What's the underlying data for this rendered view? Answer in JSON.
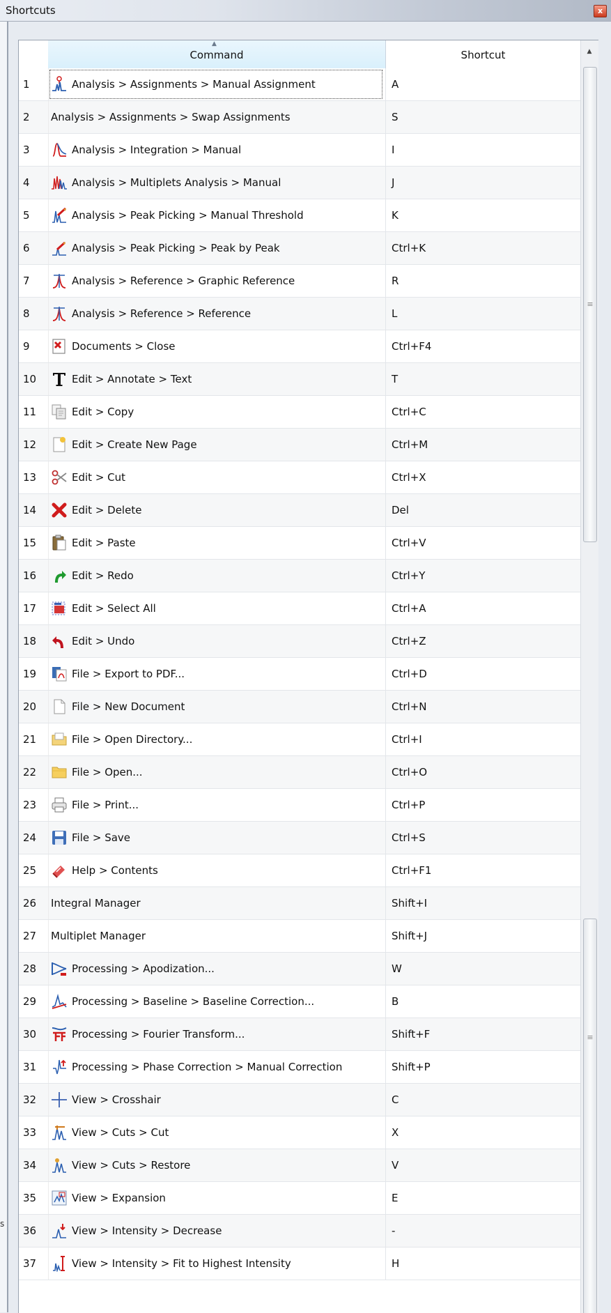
{
  "window": {
    "title": "Shortcuts",
    "close_glyph": "x"
  },
  "table": {
    "columns": {
      "command": "Command",
      "shortcut": "Shortcut"
    },
    "rows": [
      {
        "n": "1",
        "command": "Analysis > Assignments > Manual Assignment",
        "shortcut": "A",
        "icon": "manual-assignment-icon"
      },
      {
        "n": "2",
        "command": "Analysis > Assignments > Swap Assignments",
        "shortcut": "S",
        "icon": ""
      },
      {
        "n": "3",
        "command": "Analysis > Integration > Manual",
        "shortcut": "I",
        "icon": "integration-icon"
      },
      {
        "n": "4",
        "command": "Analysis > Multiplets Analysis > Manual",
        "shortcut": "J",
        "icon": "multiplets-icon"
      },
      {
        "n": "5",
        "command": "Analysis > Peak Picking > Manual Threshold",
        "shortcut": "K",
        "icon": "peak-threshold-icon"
      },
      {
        "n": "6",
        "command": "Analysis > Peak Picking > Peak by Peak",
        "shortcut": "Ctrl+K",
        "icon": "peak-by-peak-icon"
      },
      {
        "n": "7",
        "command": "Analysis > Reference > Graphic Reference",
        "shortcut": "R",
        "icon": "graphic-reference-icon"
      },
      {
        "n": "8",
        "command": "Analysis > Reference > Reference",
        "shortcut": "L",
        "icon": "reference-icon"
      },
      {
        "n": "9",
        "command": "Documents > Close",
        "shortcut": "Ctrl+F4",
        "icon": "close-document-icon"
      },
      {
        "n": "10",
        "command": "Edit > Annotate > Text",
        "shortcut": "T",
        "icon": "text-icon"
      },
      {
        "n": "11",
        "command": "Edit > Copy",
        "shortcut": "Ctrl+C",
        "icon": "copy-icon"
      },
      {
        "n": "12",
        "command": "Edit > Create New Page",
        "shortcut": "Ctrl+M",
        "icon": "new-page-icon"
      },
      {
        "n": "13",
        "command": "Edit > Cut",
        "shortcut": "Ctrl+X",
        "icon": "scissors-icon"
      },
      {
        "n": "14",
        "command": "Edit > Delete",
        "shortcut": "Del",
        "icon": "delete-icon"
      },
      {
        "n": "15",
        "command": "Edit > Paste",
        "shortcut": "Ctrl+V",
        "icon": "paste-icon"
      },
      {
        "n": "16",
        "command": "Edit > Redo",
        "shortcut": "Ctrl+Y",
        "icon": "redo-icon"
      },
      {
        "n": "17",
        "command": "Edit > Select All",
        "shortcut": "Ctrl+A",
        "icon": "select-all-icon"
      },
      {
        "n": "18",
        "command": "Edit > Undo",
        "shortcut": "Ctrl+Z",
        "icon": "undo-icon"
      },
      {
        "n": "19",
        "command": "File > Export to PDF...",
        "shortcut": "Ctrl+D",
        "icon": "export-pdf-icon"
      },
      {
        "n": "20",
        "command": "File > New Document",
        "shortcut": "Ctrl+N",
        "icon": "new-document-icon"
      },
      {
        "n": "21",
        "command": "File > Open Directory...",
        "shortcut": "Ctrl+I",
        "icon": "open-directory-icon"
      },
      {
        "n": "22",
        "command": "File > Open...",
        "shortcut": "Ctrl+O",
        "icon": "open-folder-icon"
      },
      {
        "n": "23",
        "command": "File > Print...",
        "shortcut": "Ctrl+P",
        "icon": "printer-icon"
      },
      {
        "n": "24",
        "command": "File > Save",
        "shortcut": "Ctrl+S",
        "icon": "save-icon"
      },
      {
        "n": "25",
        "command": "Help > Contents",
        "shortcut": "Ctrl+F1",
        "icon": "help-icon"
      },
      {
        "n": "26",
        "command": "Integral Manager",
        "shortcut": "Shift+I",
        "icon": ""
      },
      {
        "n": "27",
        "command": "Multiplet Manager",
        "shortcut": "Shift+J",
        "icon": ""
      },
      {
        "n": "28",
        "command": "Processing > Apodization...",
        "shortcut": "W",
        "icon": "apodization-icon"
      },
      {
        "n": "29",
        "command": "Processing > Baseline > Baseline Correction...",
        "shortcut": "B",
        "icon": "baseline-icon"
      },
      {
        "n": "30",
        "command": "Processing > Fourier Transform...",
        "shortcut": "Shift+F",
        "icon": "fourier-icon"
      },
      {
        "n": "31",
        "command": "Processing > Phase Correction > Manual Correction",
        "shortcut": "Shift+P",
        "icon": "phase-icon"
      },
      {
        "n": "32",
        "command": "View > Crosshair",
        "shortcut": "C",
        "icon": "crosshair-icon"
      },
      {
        "n": "33",
        "command": "View > Cuts > Cut",
        "shortcut": "X",
        "icon": "cut-view-icon"
      },
      {
        "n": "34",
        "command": "View > Cuts > Restore",
        "shortcut": "V",
        "icon": "restore-icon"
      },
      {
        "n": "35",
        "command": "View > Expansion",
        "shortcut": "E",
        "icon": "expansion-icon"
      },
      {
        "n": "36",
        "command": "View > Intensity > Decrease",
        "shortcut": "-",
        "icon": "intensity-decrease-icon"
      },
      {
        "n": "37",
        "command": "View > Intensity > Fit to Highest Intensity",
        "shortcut": "H",
        "icon": "fit-intensity-icon"
      }
    ]
  },
  "scrollbar": {
    "grip_glyph": "≡"
  },
  "colors": {
    "accent_red": "#d01c1c",
    "accent_blue": "#2b5fb0",
    "header_sort_bg": "#d9f0fc",
    "row_alt": "#f6f7f8"
  }
}
